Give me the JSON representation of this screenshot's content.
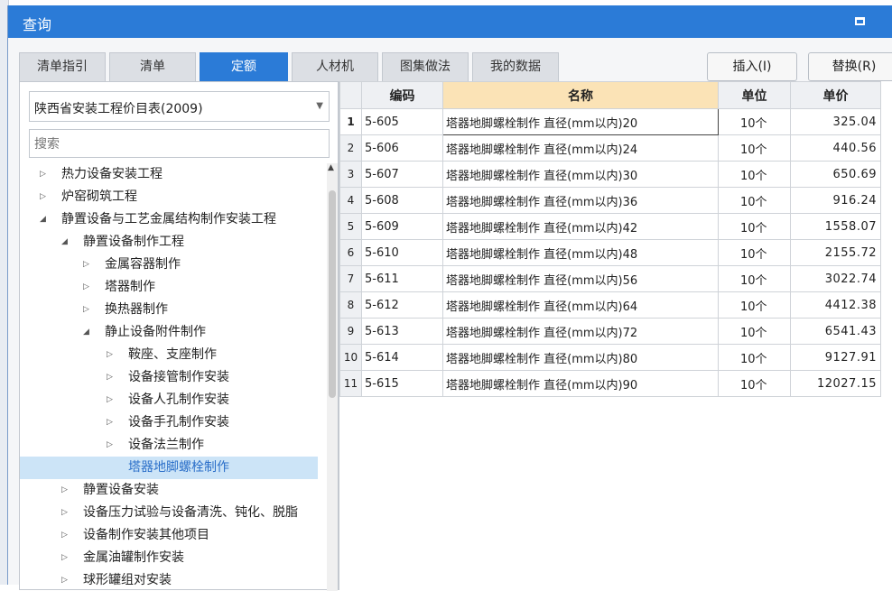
{
  "window": {
    "title": "查询"
  },
  "tabs": [
    "清单指引",
    "清单",
    "定额",
    "人材机",
    "图集做法",
    "我的数据"
  ],
  "active_tab": "定额",
  "actions": {
    "insert": "插入(I)",
    "replace": "替换(R)"
  },
  "library": {
    "selected": "陕西省安装工程价目表(2009)"
  },
  "search": {
    "placeholder": "搜索"
  },
  "tree": [
    {
      "label": "热力设备安装工程",
      "level": 0,
      "expanded": false
    },
    {
      "label": "炉窑砌筑工程",
      "level": 0,
      "expanded": false
    },
    {
      "label": "静置设备与工艺金属结构制作安装工程",
      "level": 0,
      "expanded": true
    },
    {
      "label": "静置设备制作工程",
      "level": 1,
      "expanded": true
    },
    {
      "label": "金属容器制作",
      "level": 2,
      "expanded": false
    },
    {
      "label": "塔器制作",
      "level": 2,
      "expanded": false
    },
    {
      "label": "换热器制作",
      "level": 2,
      "expanded": false
    },
    {
      "label": "静止设备附件制作",
      "level": 2,
      "expanded": true
    },
    {
      "label": "鞍座、支座制作",
      "level": 3,
      "expanded": false
    },
    {
      "label": "设备接管制作安装",
      "level": 3,
      "expanded": false
    },
    {
      "label": "设备人孔制作安装",
      "level": 3,
      "expanded": false
    },
    {
      "label": "设备手孔制作安装",
      "level": 3,
      "expanded": false
    },
    {
      "label": "设备法兰制作",
      "level": 3,
      "expanded": false
    },
    {
      "label": "塔器地脚螺栓制作",
      "level": 3,
      "leaf": true,
      "selected": true
    },
    {
      "label": "静置设备安装",
      "level": 1,
      "expanded": false
    },
    {
      "label": "设备压力试验与设备清洗、钝化、脱脂",
      "level": 1,
      "expanded": false
    },
    {
      "label": "设备制作安装其他项目",
      "level": 1,
      "expanded": false
    },
    {
      "label": "金属油罐制作安装",
      "level": 1,
      "expanded": false
    },
    {
      "label": "球形罐组对安装",
      "level": 1,
      "expanded": false
    }
  ],
  "table": {
    "headers": [
      "编码",
      "名称",
      "单位",
      "单价"
    ],
    "rows": [
      {
        "n": "1",
        "code": "5-605",
        "name": "塔器地脚螺栓制作 直径(mm以内)20",
        "unit": "10个",
        "price": "325.04"
      },
      {
        "n": "2",
        "code": "5-606",
        "name": "塔器地脚螺栓制作 直径(mm以内)24",
        "unit": "10个",
        "price": "440.56"
      },
      {
        "n": "3",
        "code": "5-607",
        "name": "塔器地脚螺栓制作 直径(mm以内)30",
        "unit": "10个",
        "price": "650.69"
      },
      {
        "n": "4",
        "code": "5-608",
        "name": "塔器地脚螺栓制作 直径(mm以内)36",
        "unit": "10个",
        "price": "916.24"
      },
      {
        "n": "5",
        "code": "5-609",
        "name": "塔器地脚螺栓制作 直径(mm以内)42",
        "unit": "10个",
        "price": "1558.07"
      },
      {
        "n": "6",
        "code": "5-610",
        "name": "塔器地脚螺栓制作 直径(mm以内)48",
        "unit": "10个",
        "price": "2155.72"
      },
      {
        "n": "7",
        "code": "5-611",
        "name": "塔器地脚螺栓制作 直径(mm以内)56",
        "unit": "10个",
        "price": "3022.74"
      },
      {
        "n": "8",
        "code": "5-612",
        "name": "塔器地脚螺栓制作 直径(mm以内)64",
        "unit": "10个",
        "price": "4412.38"
      },
      {
        "n": "9",
        "code": "5-613",
        "name": "塔器地脚螺栓制作 直径(mm以内)72",
        "unit": "10个",
        "price": "6541.43"
      },
      {
        "n": "10",
        "code": "5-614",
        "name": "塔器地脚螺栓制作 直径(mm以内)80",
        "unit": "10个",
        "price": "9127.91"
      },
      {
        "n": "11",
        "code": "5-615",
        "name": "塔器地脚螺栓制作 直径(mm以内)90",
        "unit": "10个",
        "price": "12027.15"
      }
    ]
  },
  "colors": {
    "accent": "#2b7bd7",
    "selection": "#cce4f7",
    "header_highlight": "#fbe3b6"
  },
  "icons": [
    "maximize-icon",
    "close-icon",
    "dropdown-arrow-icon",
    "tree-expand-icon",
    "tree-collapse-icon",
    "scroll-up-icon"
  ]
}
